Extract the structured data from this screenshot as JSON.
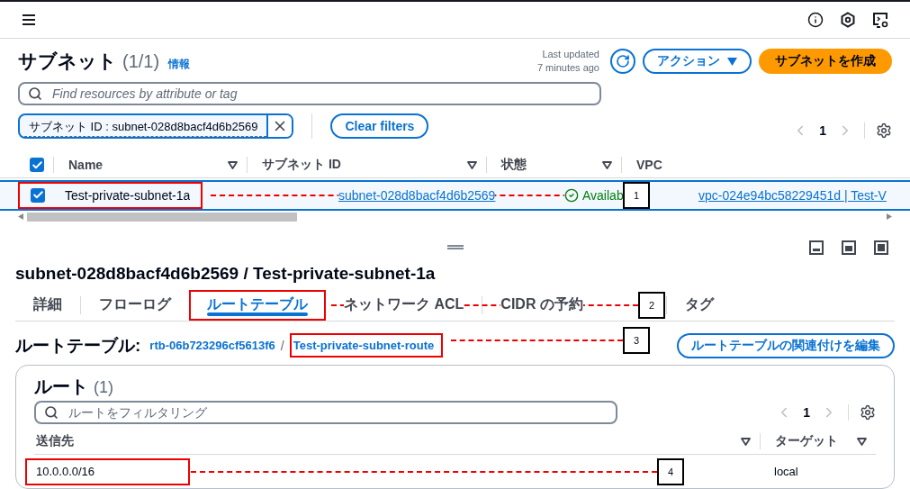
{
  "header": {
    "title": "サブネット",
    "count": "(1/1)",
    "info_link": "情報",
    "last_updated": "Last updated",
    "updated_ago": "7 minutes ago",
    "actions_button": "アクション",
    "create_button": "サブネットを作成"
  },
  "search": {
    "placeholder": "Find resources by attribute or tag"
  },
  "filter_token": {
    "label": "サブネット ID : subnet-028d8bacf4d6b2569"
  },
  "clear_filters_button": "Clear filters",
  "pagination": {
    "page": "1"
  },
  "table": {
    "all_checked": true,
    "columns": [
      {
        "label": "Name"
      },
      {
        "label": "サブネット ID"
      },
      {
        "label": "状態"
      },
      {
        "label": "VPC"
      }
    ],
    "rows": [
      {
        "selected": true,
        "checked": true,
        "highlighted": true,
        "name": "Test-private-subnet-1a",
        "subnet_id": "subnet-028d8bacf4d6b2569",
        "status": "Availab",
        "vpc": "vpc-024e94bc58229451d | Test-V",
        "callout": "1"
      }
    ]
  },
  "detail": {
    "title": "subnet-028d8bacf4d6b2569 / Test-private-subnet-1a",
    "tabs": [
      {
        "label": "詳細",
        "selected": false,
        "highlighted": false
      },
      {
        "label": "フローログ",
        "selected": false,
        "highlighted": false
      },
      {
        "label": "ルートテーブル",
        "selected": true,
        "highlighted": true
      },
      {
        "label": "ネットワーク ACL",
        "selected": false,
        "highlighted": false
      },
      {
        "label": "CIDR の予約",
        "selected": false,
        "highlighted": false
      },
      {
        "label": "タグ",
        "selected": false,
        "highlighted": false
      }
    ],
    "tab_callout": "2",
    "route_table": {
      "label": "ルートテーブル:",
      "id": "rtb-06b723296cf5613f6",
      "separator": "/",
      "name": "Test-private-subnet-route",
      "highlighted": true,
      "callout": "3",
      "edit_button": "ルートテーブルの関連付けを編集"
    },
    "routes": {
      "title": "ルート",
      "count": "(1)",
      "search_placeholder": "ルートをフィルタリング",
      "page": "1",
      "columns": [
        {
          "label": "送信先"
        },
        {
          "label": "ターゲット"
        }
      ],
      "rows": [
        {
          "destination": "10.0.0.0/16",
          "target": "local",
          "highlighted": true,
          "callout": "4"
        }
      ]
    }
  }
}
